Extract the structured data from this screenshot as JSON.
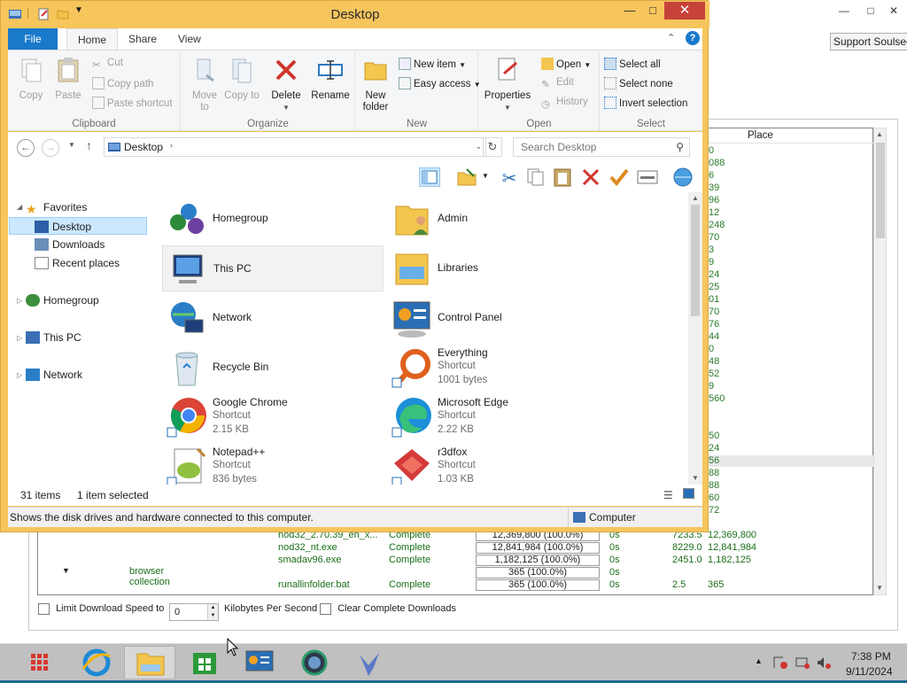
{
  "background_window": {
    "support_button": "Support Soulseek",
    "place_column": "Place",
    "place_values": [
      "0",
      "088",
      "6",
      "39",
      "96",
      "12",
      "248",
      "70",
      "3",
      "9",
      "24",
      "25",
      "01",
      "70",
      "76",
      "44",
      "0",
      "48",
      "52",
      "9",
      "560",
      "",
      "",
      "50",
      "24",
      "56",
      "88",
      "88",
      "60",
      "72"
    ],
    "downloads": [
      {
        "file": "nod32_2.70.39_en_x...",
        "status": "Complete",
        "progress": "12,369,800 (100.0%)",
        "time": "0s",
        "speed": "7233.5",
        "size": "12,369,800"
      },
      {
        "file": "nod32_nt.exe",
        "status": "Complete",
        "progress": "12,841,984 (100.0%)",
        "time": "0s",
        "speed": "8229.0",
        "size": "12,841,984"
      },
      {
        "file": "smadav96.exe",
        "status": "Complete",
        "progress": "1,182,125 (100.0%)",
        "time": "0s",
        "speed": "2451.0",
        "size": "1,182,125"
      },
      {
        "file": "",
        "status": "",
        "progress": "365 (100.0%)",
        "time": "0s",
        "speed": "",
        "size": ""
      },
      {
        "file": "runallinfolder.bat",
        "status": "Complete",
        "progress": "365 (100.0%)",
        "time": "0s",
        "speed": "2.5",
        "size": "365"
      }
    ],
    "folder_label": "browser collection",
    "limit_speed_label": "Limit Download Speed to",
    "limit_speed_value": "0",
    "kbps_label": "Kilobytes Per Second",
    "clear_label": "Clear Complete Downloads"
  },
  "explorer": {
    "title": "Desktop",
    "tabs": [
      "File",
      "Home",
      "Share",
      "View"
    ],
    "ribbon": {
      "clipboard": {
        "name": "Clipboard",
        "copy": "Copy",
        "paste": "Paste",
        "cut": "Cut",
        "copy_path": "Copy path",
        "paste_shortcut": "Paste shortcut"
      },
      "organize": {
        "name": "Organize",
        "move_to": "Move to",
        "copy_to": "Copy to",
        "delete": "Delete",
        "rename": "Rename"
      },
      "new": {
        "name": "New",
        "new_folder": "New folder",
        "new_item": "New item",
        "easy_access": "Easy access"
      },
      "open": {
        "name": "Open",
        "properties": "Properties",
        "open": "Open",
        "edit": "Edit",
        "history": "History"
      },
      "select": {
        "name": "Select",
        "select_all": "Select all",
        "select_none": "Select none",
        "invert": "Invert selection"
      }
    },
    "address": {
      "crumb": "Desktop",
      "search_placeholder": "Search Desktop"
    },
    "nav": {
      "favorites": "Favorites",
      "desktop": "Desktop",
      "downloads": "Downloads",
      "recent": "Recent places",
      "homegroup": "Homegroup",
      "thispc": "This PC",
      "network": "Network"
    },
    "items": [
      {
        "name": "Homegroup",
        "sub1": "",
        "sub2": "",
        "icon": "homegroup-icon"
      },
      {
        "name": "Admin",
        "sub1": "",
        "sub2": "",
        "icon": "user-folder-icon"
      },
      {
        "name": "This PC",
        "sub1": "",
        "sub2": "",
        "icon": "computer-icon"
      },
      {
        "name": "Libraries",
        "sub1": "",
        "sub2": "",
        "icon": "libraries-icon"
      },
      {
        "name": "Network",
        "sub1": "",
        "sub2": "",
        "icon": "network-icon"
      },
      {
        "name": "Control Panel",
        "sub1": "",
        "sub2": "",
        "icon": "control-panel-icon"
      },
      {
        "name": "Recycle Bin",
        "sub1": "",
        "sub2": "",
        "icon": "recycle-bin-icon"
      },
      {
        "name": "Everything",
        "sub1": "Shortcut",
        "sub2": "1001 bytes",
        "icon": "everything-icon"
      },
      {
        "name": "Google Chrome",
        "sub1": "Shortcut",
        "sub2": "2.15 KB",
        "icon": "chrome-icon"
      },
      {
        "name": "Microsoft Edge",
        "sub1": "Shortcut",
        "sub2": "2.22 KB",
        "icon": "edge-icon"
      },
      {
        "name": "Notepad++",
        "sub1": "Shortcut",
        "sub2": "836 bytes",
        "icon": "notepadpp-icon"
      },
      {
        "name": "r3dfox",
        "sub1": "Shortcut",
        "sub2": "1.03 KB",
        "icon": "r3dfox-icon"
      }
    ],
    "status": {
      "count": "31 items",
      "selected": "1 item selected"
    },
    "details": {
      "text": "Shows the disk drives and hardware connected to this computer.",
      "location": "Computer"
    }
  },
  "taskbar": {
    "time": "7:38 PM",
    "date": "9/11/2024"
  }
}
